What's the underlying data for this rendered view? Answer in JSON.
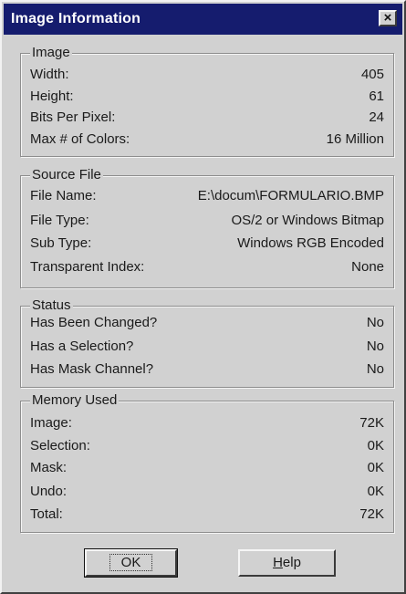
{
  "window": {
    "title": "Image Information",
    "close_glyph": "×"
  },
  "groups": {
    "image": {
      "legend": "Image",
      "rows": [
        {
          "label": "Width:",
          "value": "405"
        },
        {
          "label": "Height:",
          "value": "61"
        },
        {
          "label": "Bits Per Pixel:",
          "value": "24"
        },
        {
          "label": "Max # of Colors:",
          "value": "16 Million"
        }
      ]
    },
    "source": {
      "legend": "Source File",
      "rows": [
        {
          "label": "File Name:",
          "value": "E:\\docum\\FORMULARIO.BMP"
        },
        {
          "label": "File Type:",
          "value": "OS/2 or Windows Bitmap"
        },
        {
          "label": "Sub Type:",
          "value": "Windows RGB Encoded"
        },
        {
          "label": "Transparent Index:",
          "value": "None"
        }
      ]
    },
    "status": {
      "legend": "Status",
      "rows": [
        {
          "label": "Has Been Changed?",
          "value": "No"
        },
        {
          "label": "Has a Selection?",
          "value": "No"
        },
        {
          "label": "Has Mask Channel?",
          "value": "No"
        }
      ]
    },
    "memory": {
      "legend": "Memory Used",
      "rows": [
        {
          "label": "Image:",
          "value": "72K"
        },
        {
          "label": "Selection:",
          "value": "0K"
        },
        {
          "label": "Mask:",
          "value": "0K"
        },
        {
          "label": "Undo:",
          "value": "0K"
        },
        {
          "label": "Total:",
          "value": "72K"
        }
      ]
    }
  },
  "buttons": {
    "ok": "OK",
    "help_mnemonic": "H",
    "help_rest": "elp"
  }
}
